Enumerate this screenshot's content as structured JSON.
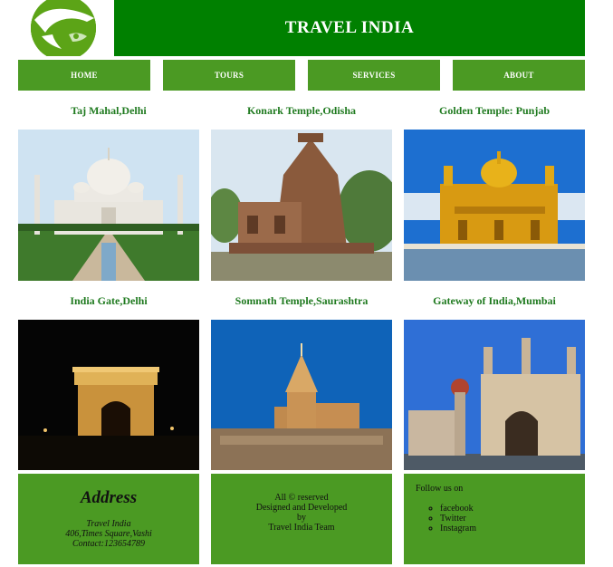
{
  "header": {
    "title": "TRAVEL INDIA"
  },
  "nav": {
    "home": "HOME",
    "tours": "TOURS",
    "services": "SERVICES",
    "about": "ABOUT"
  },
  "places": [
    {
      "caption": "Taj Mahal,Delhi"
    },
    {
      "caption": "Konark Temple,Odisha"
    },
    {
      "caption": "Golden Temple: Punjab"
    },
    {
      "caption": "India Gate,Delhi"
    },
    {
      "caption": "Somnath Temple,Saurashtra"
    },
    {
      "caption": "Gateway of India,Mumbai"
    }
  ],
  "footer": {
    "address": {
      "title": "Address",
      "lines": [
        "Travel India",
        "406,Times Square,Vashi",
        "Contact:123654789"
      ]
    },
    "copyright": {
      "lines": [
        "All © reserved",
        "Designed and Developed",
        "by",
        "Travel India Team"
      ]
    },
    "social": {
      "heading": "Follow us on",
      "links": [
        "facebook",
        "Twitter",
        "Instagram"
      ]
    }
  },
  "colors": {
    "header_green": "#008000",
    "nav_green": "#4b9a23",
    "caption_green": "#1f7a1f"
  }
}
